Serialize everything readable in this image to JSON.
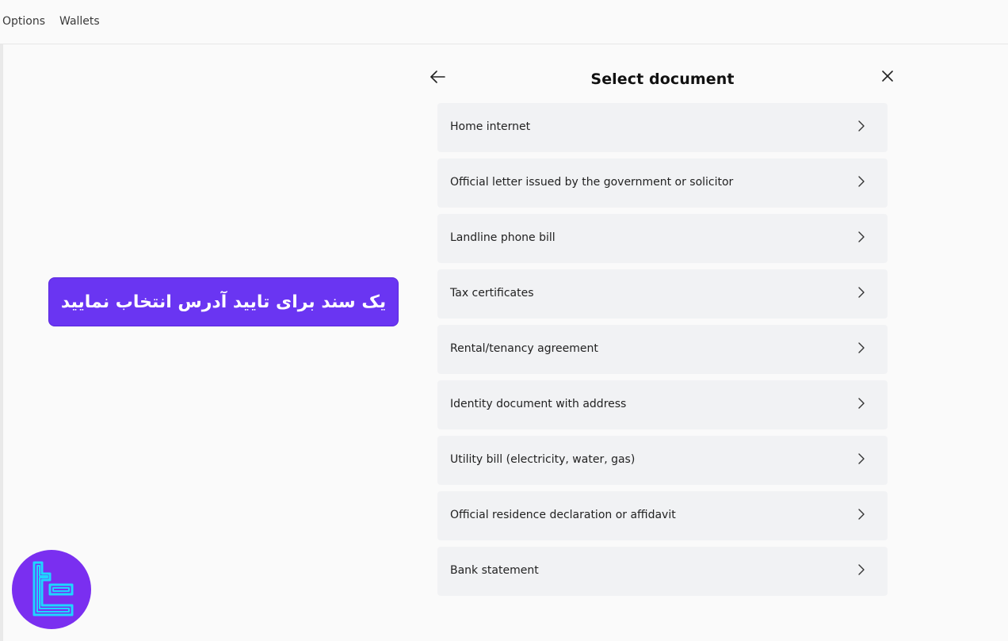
{
  "topbar": {
    "items": [
      {
        "label": "Options"
      },
      {
        "label": "Wallets"
      }
    ]
  },
  "panel": {
    "title": "Select document",
    "back_icon": "arrow-left-icon",
    "close_icon": "close-icon",
    "documents": [
      {
        "label": "Home internet"
      },
      {
        "label": "Official letter issued by the government or solicitor"
      },
      {
        "label": "Landline phone bill"
      },
      {
        "label": "Tax certificates"
      },
      {
        "label": "Rental/tenancy agreement"
      },
      {
        "label": "Identity document with address"
      },
      {
        "label": "Utility bill (electricity, water, gas)"
      },
      {
        "label": "Official residence declaration or affidavit"
      },
      {
        "label": "Bank statement"
      }
    ]
  },
  "banner": {
    "text": "یک سند برای تایید آدرس انتخاب نمایید",
    "color": "#6a35f2"
  },
  "logo": {
    "icon": "tc-logo-icon",
    "background": "#7a2ff0",
    "accent": "#1fd6ff"
  }
}
